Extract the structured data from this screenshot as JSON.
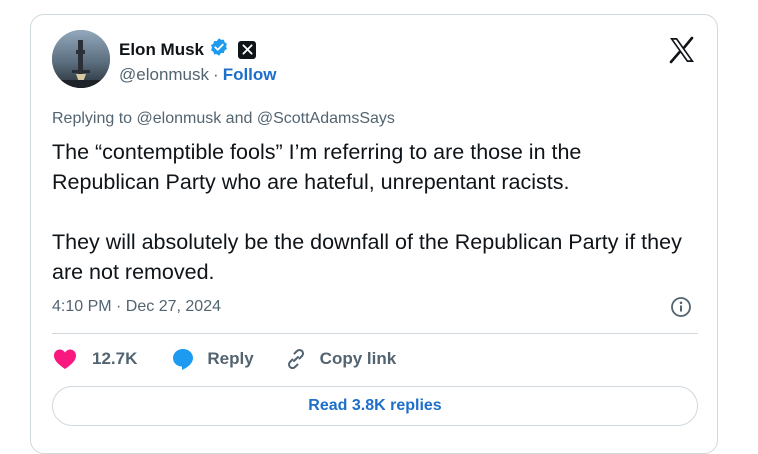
{
  "author": {
    "name": "Elon Musk",
    "handle": "@elonmusk",
    "separator": "·",
    "follow_label": "Follow",
    "verified_icon": "verified-badge-icon",
    "affiliate_icon": "x-affiliate-badge-icon"
  },
  "reply_context": {
    "prefix": "Replying to",
    "mention_1": "@elonmusk",
    "conjunction": "and",
    "mention_2": "@ScottAdamsSays"
  },
  "tweet": {
    "paragraphs": [
      "The “contemptible fools” I’m referring to are those in the Republican Party who are hateful, unrepentant racists.",
      "They will absolutely be the downfall of the Republican Party if they are not removed."
    ],
    "timestamp": "4:10 PM · Dec 27, 2024"
  },
  "actions": {
    "likes": "12.7K",
    "reply_label": "Reply",
    "copy_link_label": "Copy link"
  },
  "read_replies_label": "Read 3.8K replies",
  "colors": {
    "text": "#0f1419",
    "secondary": "#536471",
    "link": "#1d6fc9",
    "like": "#f91880",
    "verified": "#1d9bf0",
    "border": "#cfd9de"
  }
}
